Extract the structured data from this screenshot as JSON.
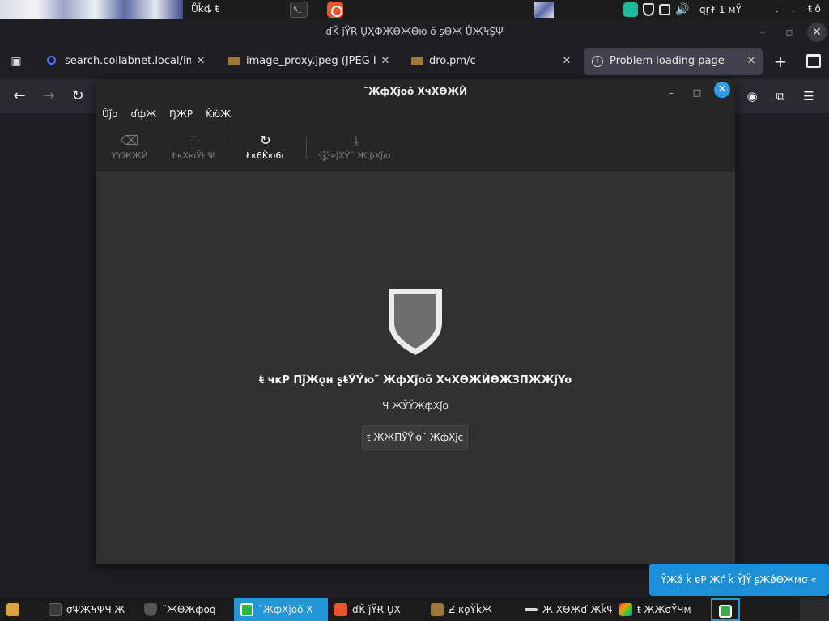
{
  "top_panel": {
    "app_title": "Ůǩȡ ŧ",
    "tray_text": "qŗ₮ 1 мŸ",
    "clock": ".  .",
    "clock2": "ŧ ō"
  },
  "browser": {
    "window_title": "ɗǨ ǰŸɌ ŲҲФЖϴЖϴю   ő ʂϴЖ ŮЖϞŞΨ",
    "tabs": [
      {
        "label": "search.collabnet.local/image",
        "icon": "search-icon",
        "active": false
      },
      {
        "label": "image_proxy.jpeg (JPEG Image",
        "icon": "folder-icon",
        "active": false
      },
      {
        "label": "dro.pm/c",
        "icon": "folder-icon",
        "active": false
      },
      {
        "label": "Problem loading page",
        "icon": "info-icon",
        "active": true
      }
    ]
  },
  "viewer": {
    "title": "˜ЖфXǰoŏ XчXϴЖЍ",
    "menu": [
      "Ŭ̈ǰo",
      "ɗфЖ",
      "ŊЖP",
      "Ǩю̈Ж"
    ],
    "tools": [
      {
        "label": "ΥΥЖЖЍ",
        "icon": "backspace-icon",
        "enabled": false
      },
      {
        "label": "ŁкXюЎŧ Ψ",
        "icon": "select-icon",
        "enabled": false
      },
      {
        "label": "Łк6Ǩю6r",
        "icon": "refresh-icon",
        "enabled": true
      },
      {
        "label": "ǯ҉ɐǰXŸ˜ ЖфXǰю",
        "icon": "download-icon",
        "enabled": false
      }
    ],
    "error_title": "ŧ чкP ПǰЖǫн ʂŧЎŸю˜ ЖфXǰoŏ XчXϴЖЍϴЖЗΠЖЖǰYo",
    "error_sub": "Ч ЖЎŸЖфXǰo",
    "button_label": "ŧ ЖЖΠЎŸю˜ ЖфXǰc"
  },
  "notification": {
    "text": "ŶЖǿ ǩ ɐP Жѓ ǩ ŶǰŸ ʂЖǿϴЖмσ  «"
  },
  "taskbar": {
    "items": [
      {
        "label": "",
        "icon": "files-icon"
      },
      {
        "label": "σΨЖϞΨЧ Ж",
        "icon": "terminal-icon"
      },
      {
        "label": "˜ЖϴЖфoq",
        "icon": "shield-icon"
      },
      {
        "label": "˜ЖфXǰoŏ X",
        "icon": "shield-green-icon",
        "active": true
      },
      {
        "label": "ɗǨ ǰŸɌ ŲX",
        "icon": "firefox-icon"
      },
      {
        "label": "Ƶ кǫŸǩЖ",
        "icon": "folder-icon"
      },
      {
        "label": "Ж XϴЖɗ ЖǩΨ",
        "icon": "minus-icon"
      },
      {
        "label": "ŧ ЖЖσŸЧм",
        "icon": "paint-icon"
      },
      {
        "label": "",
        "icon": "shield-green-icon",
        "selected": true
      }
    ]
  },
  "colors": {
    "accent": "#2397d8",
    "dialog_bg": "#313131",
    "notification": "#1d8fd6"
  }
}
